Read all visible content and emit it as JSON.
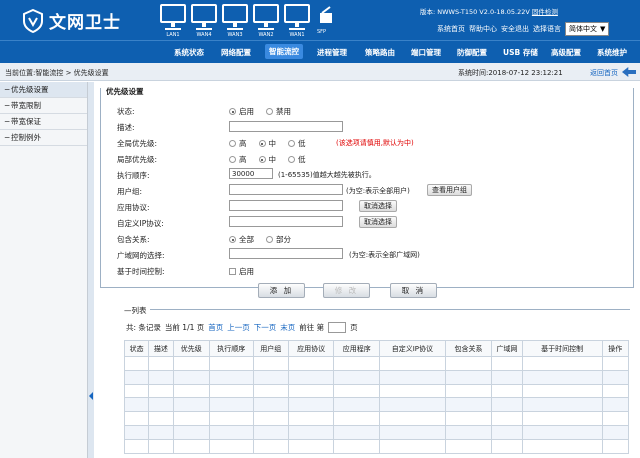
{
  "header": {
    "brand": "文网卫士",
    "ports": [
      "LAN1",
      "WAN4",
      "WAN3",
      "WAN2",
      "WAN1"
    ],
    "sfp": "SFP",
    "version_label": "版本: NWWS-T150 V2.0-18.05.22V",
    "firmware_link": "固件检测",
    "links": [
      "系统首页",
      "帮助中心",
      "安全退出",
      "选择语言"
    ],
    "language": "简体中文"
  },
  "nav": [
    "系统状态",
    "网络配置",
    "智能流控",
    "进程管理",
    "策略路由",
    "端口管理",
    "防御配置",
    "USB 存储",
    "高级配置",
    "系统维护"
  ],
  "breadcrumb": "当前位置:智能流控 > 优先级设置",
  "system_time": "系统时间:2018-07-12 23:12:21",
  "back_label": "返回首页",
  "sidebar": [
    {
      "label": "优先级设置"
    },
    {
      "label": "带宽限制"
    },
    {
      "label": "带宽保证"
    },
    {
      "label": "控制例外"
    }
  ],
  "form": {
    "legend": "优先级设置",
    "status": {
      "label": "状态:",
      "opt1": "启用",
      "opt2": "禁用"
    },
    "desc_label": "描述:",
    "global": {
      "label": "全局优先级:",
      "opt1": "高",
      "opt2": "中",
      "opt3": "低",
      "note": "(该选项请慎用,默认为中)"
    },
    "local": {
      "label": "局部优先级:",
      "opt1": "高",
      "opt2": "中",
      "opt3": "低"
    },
    "order": {
      "label": "执行顺序:",
      "value": "30000",
      "note": "(1-65535)值越大越先被执行。"
    },
    "usergroup": {
      "label": "用户组:",
      "note": "(为空:表示全部用户)",
      "button": "查看用户组"
    },
    "app": {
      "label": "应用协议:",
      "button": "取消选择"
    },
    "customip": {
      "label": "自定义IP协议:",
      "button": "取消选择"
    },
    "include": {
      "label": "包含关系:",
      "opt1": "全部",
      "opt2": "部分"
    },
    "wan": {
      "label": "广域网的选择:",
      "note": "(为空:表示全部广域网)"
    },
    "timectl": {
      "label": "基于时间控制:",
      "opt": "启用"
    },
    "buttons": {
      "add": "添 加",
      "edit": "修 改",
      "cancel": "取 消"
    }
  },
  "list": {
    "title": "列表",
    "pager": {
      "total": "共: 条记录",
      "current": "当前 1/1 页",
      "first": "首页",
      "prev": "上一页",
      "next": "下一页",
      "last": "末页",
      "goto": "前往 第",
      "page": "页"
    },
    "columns": [
      "状态",
      "描述",
      "优先级",
      "执行顺序",
      "用户组",
      "应用协议",
      "应用程序",
      "自定义IP协议",
      "包含关系",
      "广域网",
      "基于时间控制",
      "操作"
    ]
  },
  "colors": {
    "header_bg": "#0e5fb0",
    "active_tab": "#3a8ae0",
    "link": "#1565c0",
    "warn": "#e00000"
  }
}
